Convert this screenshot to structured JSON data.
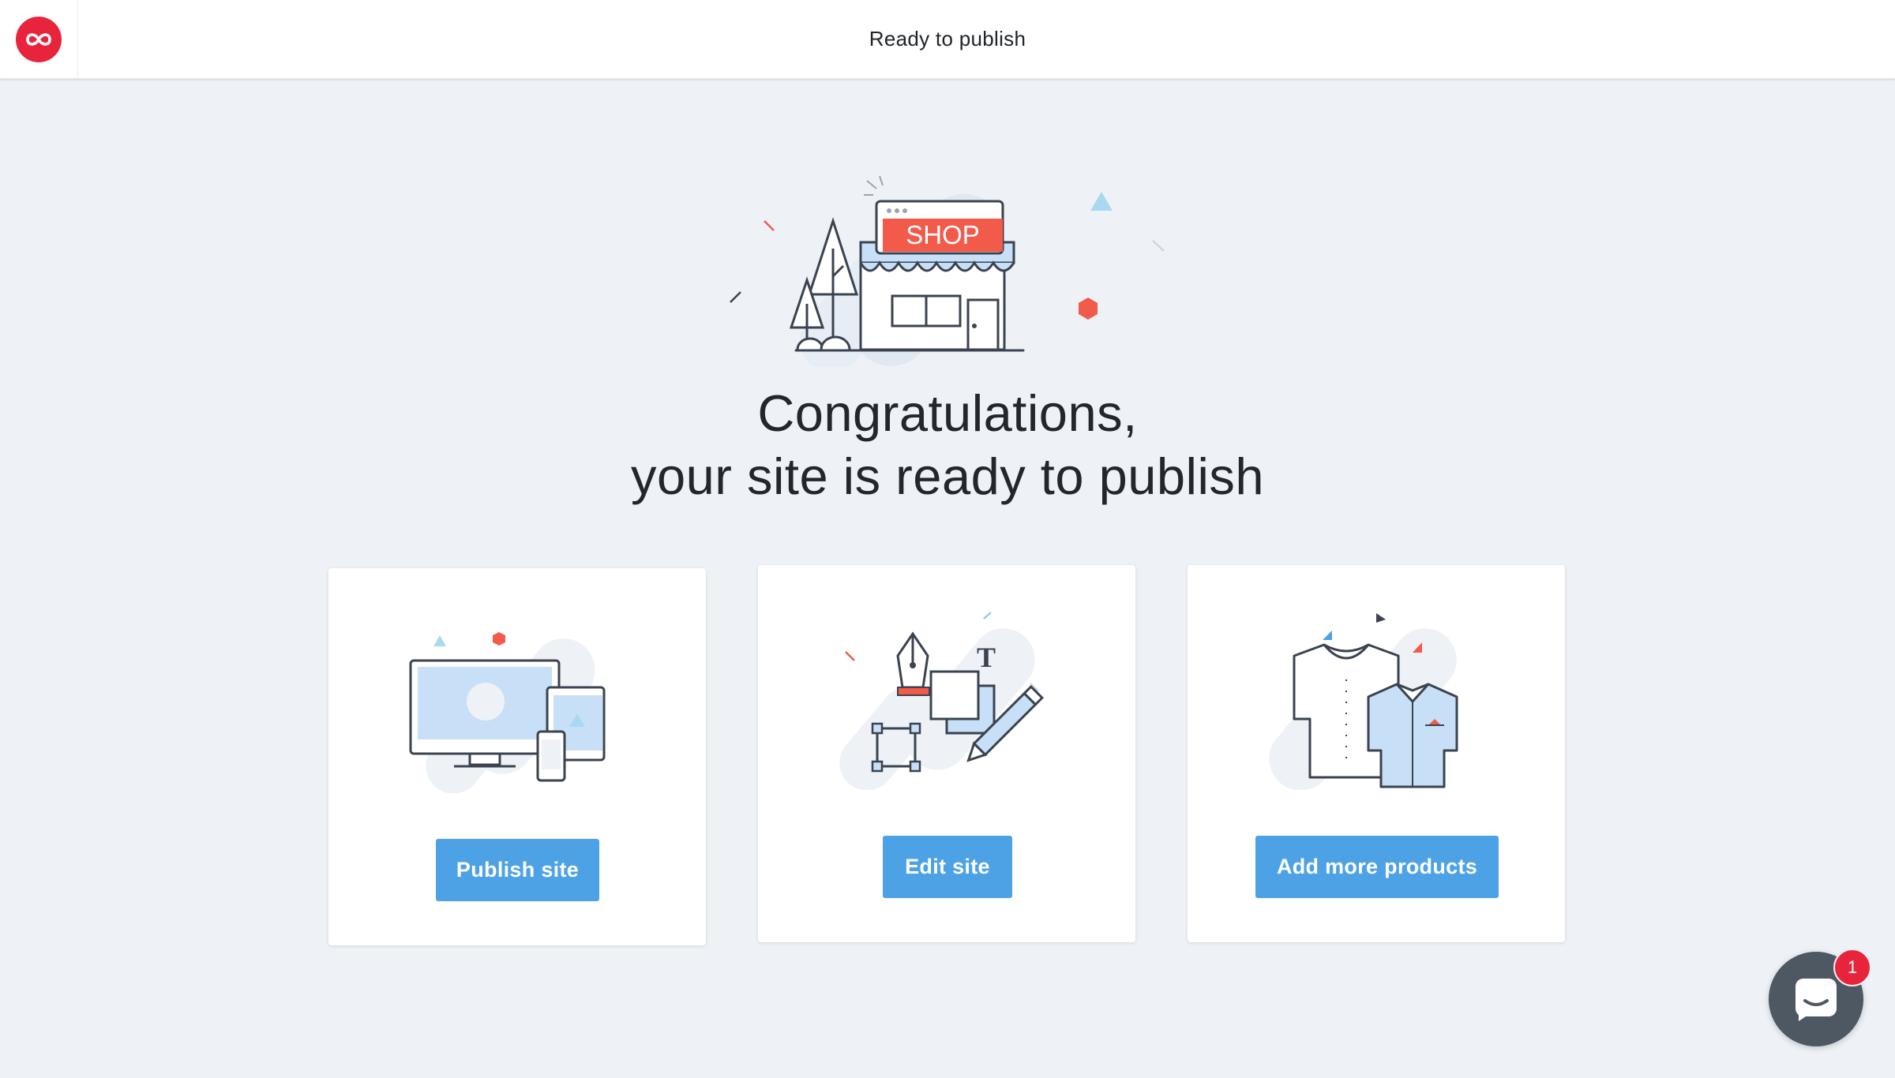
{
  "header": {
    "title": "Ready to publish",
    "logo_icon": "infinity-icon",
    "brand_color": "#e8243c"
  },
  "hero": {
    "sign_text": "SHOP",
    "headline_line1": "Congratulations,",
    "headline_line2": "your site is ready to publish"
  },
  "cards": [
    {
      "icon": "devices-icon",
      "button_label": "Publish site"
    },
    {
      "icon": "design-tools-icon",
      "button_label": "Edit site"
    },
    {
      "icon": "shirts-icon",
      "button_label": "Add more products"
    }
  ],
  "chat": {
    "icon": "chat-icon",
    "badge_count": "1"
  },
  "colors": {
    "accent": "#4da2e6",
    "background": "#eef2f6",
    "badge": "#e8243c",
    "illustration_fill": "#c7e0f7",
    "illustration_red": "#f25a4a"
  }
}
